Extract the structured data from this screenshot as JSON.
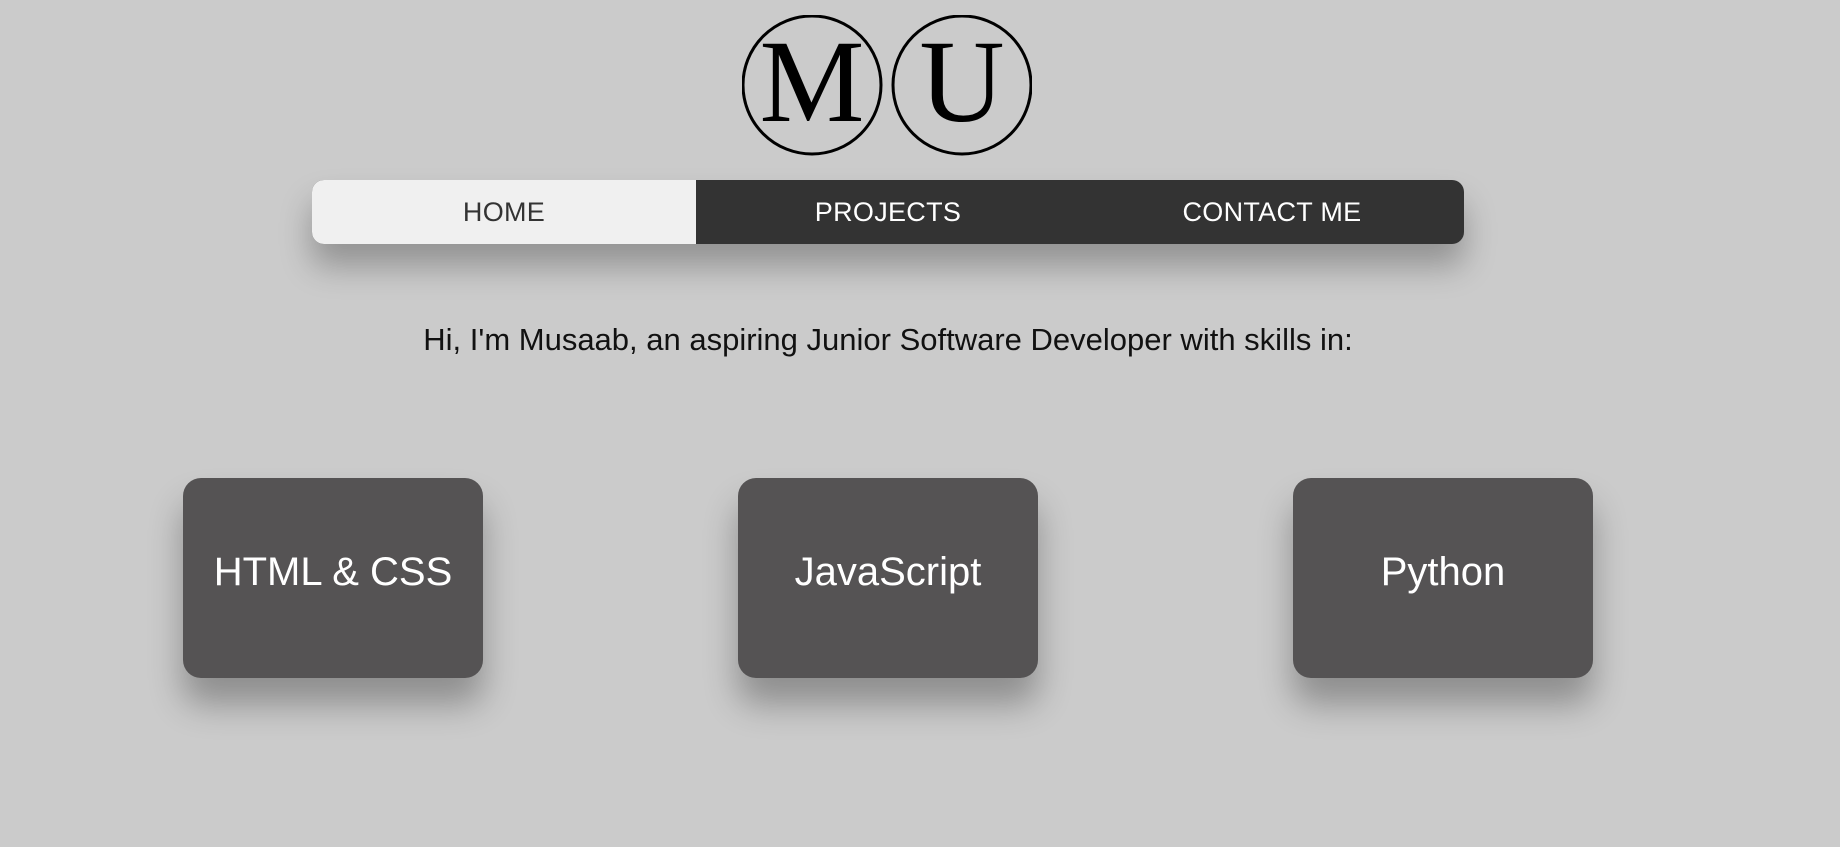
{
  "logo": {
    "letters": [
      "M",
      "U"
    ]
  },
  "nav": {
    "items": [
      {
        "label": "HOME",
        "active": true
      },
      {
        "label": "PROJECTS",
        "active": false
      },
      {
        "label": "CONTACT ME",
        "active": false
      }
    ]
  },
  "intro": {
    "text": "Hi, I'm Musaab, an aspiring Junior Software Developer with skills in:"
  },
  "skills": [
    {
      "label": "HTML & CSS"
    },
    {
      "label": "JavaScript"
    },
    {
      "label": "Python"
    }
  ],
  "colors": {
    "background": "#cbcbcb",
    "nav_background": "#333333",
    "nav_active": "#f0f0f0",
    "card_background": "#555354"
  }
}
